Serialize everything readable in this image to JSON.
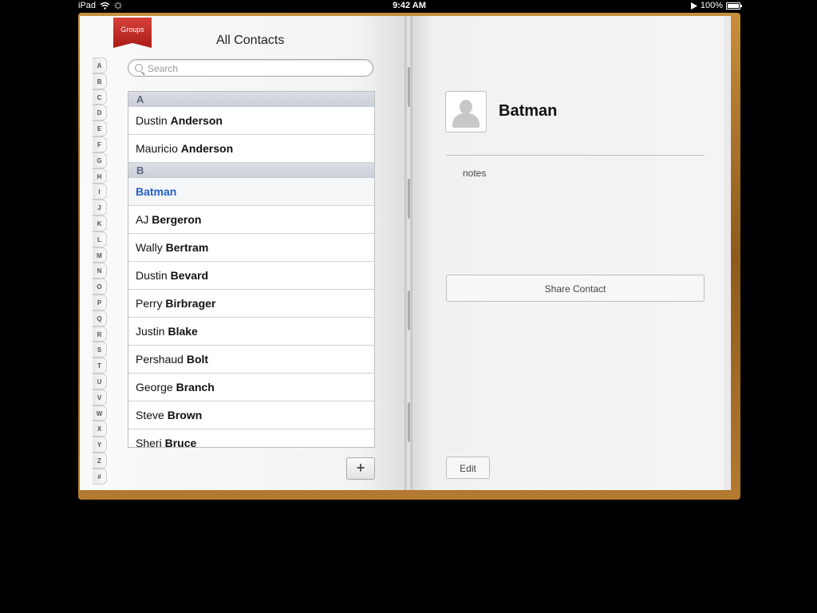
{
  "status": {
    "device": "iPad",
    "time": "9:42 AM",
    "battery": "100%"
  },
  "groups_label": "Groups",
  "title": "All Contacts",
  "search": {
    "placeholder": "Search",
    "value": ""
  },
  "index": [
    "A",
    "B",
    "C",
    "D",
    "E",
    "F",
    "G",
    "H",
    "I",
    "J",
    "K",
    "L",
    "M",
    "N",
    "O",
    "P",
    "Q",
    "R",
    "S",
    "T",
    "U",
    "V",
    "W",
    "X",
    "Y",
    "Z",
    "#"
  ],
  "sections": [
    {
      "letter": "A",
      "contacts": [
        {
          "first": "Dustin",
          "last": "Anderson"
        },
        {
          "first": "Mauricio",
          "last": "Anderson"
        }
      ]
    },
    {
      "letter": "B",
      "contacts": [
        {
          "first": "",
          "last": "Batman",
          "selected": true
        },
        {
          "first": "AJ",
          "last": "Bergeron"
        },
        {
          "first": "Wally",
          "last": "Bertram"
        },
        {
          "first": "Dustin",
          "last": "Bevard"
        },
        {
          "first": "Perry",
          "last": "Birbrager"
        },
        {
          "first": "Justin",
          "last": "Blake"
        },
        {
          "first": "Pershaud",
          "last": "Bolt"
        },
        {
          "first": "George",
          "last": "Branch"
        },
        {
          "first": "Steve",
          "last": "Brown"
        },
        {
          "first": "Sheri",
          "last": "Bruce"
        }
      ]
    }
  ],
  "add_label": "+",
  "detail": {
    "name": "Batman",
    "notes_label": "notes",
    "share_label": "Share Contact",
    "edit_label": "Edit"
  },
  "colors": {
    "accent": "#2060c8",
    "ribbon": "#c0302a",
    "leather": "#a8702a"
  },
  "icons": {
    "wifi": "wifi-icon",
    "activity": "activity-spinner-icon",
    "play": "play-icon",
    "battery": "battery-icon",
    "search": "search-icon",
    "avatar": "avatar-placeholder-icon"
  }
}
